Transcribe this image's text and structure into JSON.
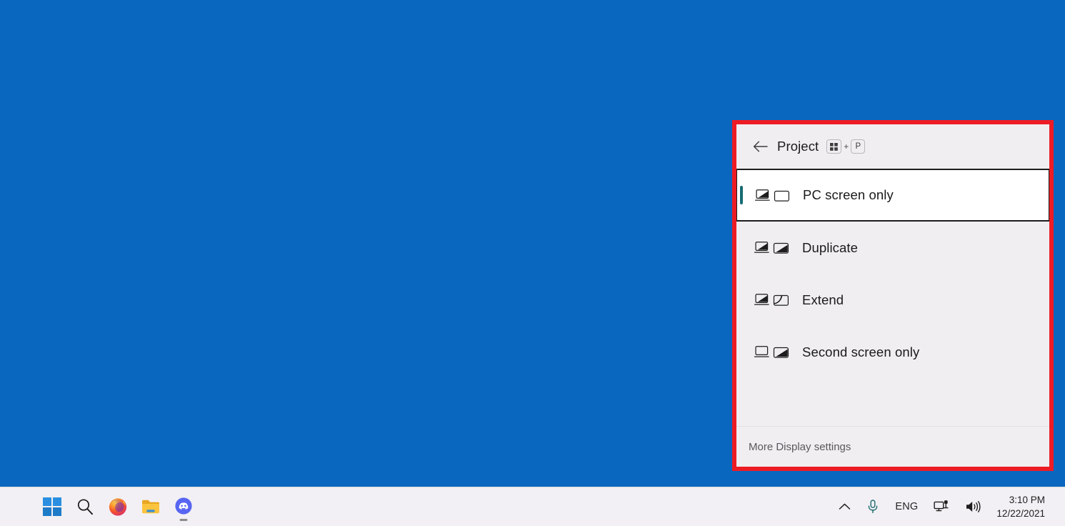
{
  "desktop": {
    "background_color": "#0a67c0"
  },
  "project_panel": {
    "highlight_border_color": "#ed1c24",
    "background_color": "#f0eef1",
    "accent_color": "#176b74",
    "header": {
      "back_icon": "back-arrow-icon",
      "title": "Project",
      "shortcut": {
        "win_key_icon": "windows-key-icon",
        "separator": "+",
        "key": "P"
      }
    },
    "options": [
      {
        "label": "PC screen only",
        "selected": true,
        "laptop_active": true,
        "monitor_active": false,
        "monitor_style": "full",
        "icon_name": "display-pc-screen-only-icon"
      },
      {
        "label": "Duplicate",
        "selected": false,
        "laptop_active": true,
        "monitor_active": true,
        "monitor_style": "full",
        "icon_name": "display-duplicate-icon"
      },
      {
        "label": "Extend",
        "selected": false,
        "laptop_active": true,
        "monitor_active": true,
        "monitor_style": "partial",
        "icon_name": "display-extend-icon"
      },
      {
        "label": "Second screen only",
        "selected": false,
        "laptop_active": false,
        "monitor_active": true,
        "monitor_style": "full",
        "icon_name": "display-second-screen-only-icon"
      }
    ],
    "footer": {
      "link_label": "More Display settings"
    }
  },
  "taskbar": {
    "background_color": "#f2f0f4",
    "apps": [
      {
        "name": "start-button",
        "icon": "windows-logo-icon",
        "running": false
      },
      {
        "name": "search-button",
        "icon": "search-icon",
        "running": false
      },
      {
        "name": "firefox-button",
        "icon": "firefox-icon",
        "running": false
      },
      {
        "name": "file-explorer-button",
        "icon": "folder-icon",
        "running": false
      },
      {
        "name": "discord-button",
        "icon": "discord-icon",
        "running": true
      }
    ],
    "tray": {
      "overflow_icon": "chevron-up-icon",
      "microphone_icon": "microphone-icon",
      "language": "ENG",
      "network_icon": "remote-connection-icon",
      "volume_icon": "speaker-icon",
      "time": "3:10 PM",
      "date": "12/22/2021"
    }
  }
}
